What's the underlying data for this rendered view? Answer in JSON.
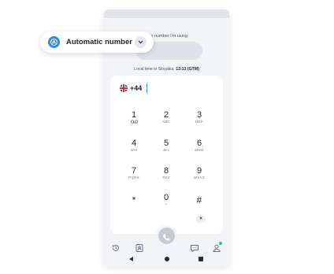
{
  "screen": {
    "number_label": "The number I'm using",
    "local_time_prefix": "Local time in Slovakia:",
    "local_time_value": "13:13 (GTM)"
  },
  "dialer": {
    "country_flag": "uk-flag-icon",
    "country_code": "+44",
    "keys": [
      {
        "digit": "1",
        "letters": "",
        "sub_icon": "voicemail-icon"
      },
      {
        "digit": "2",
        "letters": "ABC"
      },
      {
        "digit": "3",
        "letters": "DEF"
      },
      {
        "digit": "4",
        "letters": "GHI"
      },
      {
        "digit": "5",
        "letters": "JKL"
      },
      {
        "digit": "6",
        "letters": "MNO"
      },
      {
        "digit": "7",
        "letters": "PQRS"
      },
      {
        "digit": "8",
        "letters": "TUV"
      },
      {
        "digit": "9",
        "letters": "WXYZ"
      },
      {
        "digit": "*",
        "letters": ""
      },
      {
        "digit": "0",
        "letters": "+"
      },
      {
        "digit": "#",
        "letters": ""
      }
    ],
    "erase_glyph": "×"
  },
  "bottom_nav": {
    "items": [
      "history-icon",
      "contacts-icon",
      "call-icon",
      "messages-icon",
      "profile-icon"
    ]
  },
  "number_selector": {
    "label": "Automatic number",
    "icon": "automatic-number-icon",
    "chevron": "chevron-down-icon"
  },
  "colors": {
    "accent": "#2f8cdd",
    "online": "#34c25a",
    "background": "#f3f4f7"
  }
}
